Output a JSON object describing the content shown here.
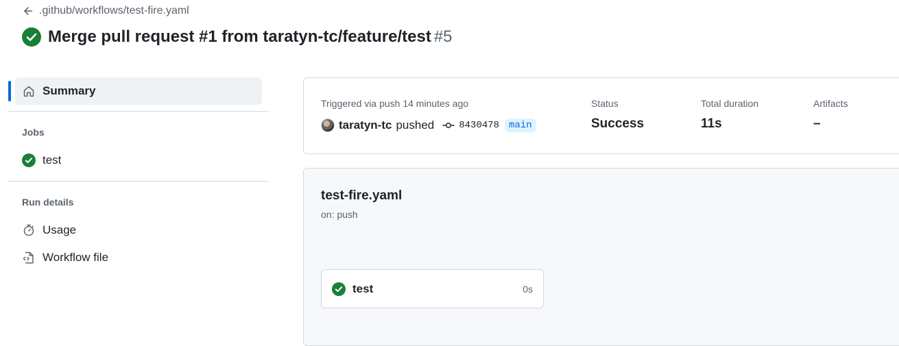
{
  "header": {
    "back_path": ".github/workflows/test-fire.yaml",
    "title": "Merge pull request #1 from taratyn-tc/feature/test",
    "run_number": "#5",
    "status_color": "#1a7f37"
  },
  "sidebar": {
    "summary_label": "Summary",
    "jobs_heading": "Jobs",
    "jobs": [
      {
        "label": "test",
        "status": "success"
      }
    ],
    "run_details_heading": "Run details",
    "run_details": [
      {
        "label": "Usage",
        "icon": "stopwatch-icon"
      },
      {
        "label": "Workflow file",
        "icon": "file-code-icon"
      }
    ]
  },
  "summary": {
    "trigger_text": "Triggered via push 14 minutes ago",
    "actor": "taratyn-tc",
    "action": "pushed",
    "commit_sha": "8430478",
    "branch": "main",
    "status_label": "Status",
    "status_value": "Success",
    "duration_label": "Total duration",
    "duration_value": "11s",
    "artifacts_label": "Artifacts",
    "artifacts_value": "–"
  },
  "workflow": {
    "file_name": "test-fire.yaml",
    "trigger": "on: push",
    "jobs": [
      {
        "label": "test",
        "duration": "0s",
        "status": "success"
      }
    ]
  }
}
